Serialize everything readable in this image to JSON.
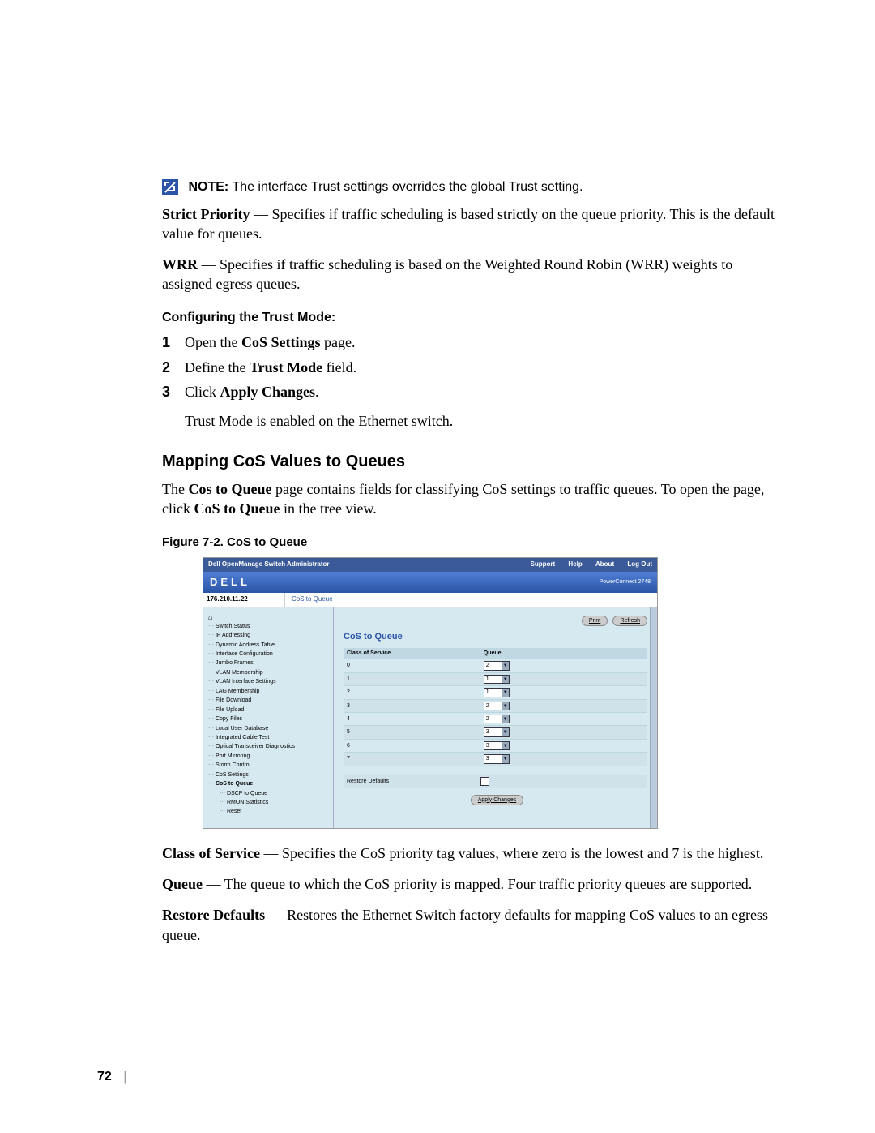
{
  "note": {
    "label": "NOTE:",
    "text": "The interface Trust settings overrides the global Trust setting."
  },
  "paras": {
    "strict": {
      "lead": "Strict Priority",
      "text": " — Specifies if traffic scheduling is based strictly on the queue priority. This is the default value for queues."
    },
    "wrr": {
      "lead": "WRR",
      "text": " — Specifies if traffic scheduling is based on the Weighted Round Robin (WRR) weights to assigned egress queues."
    }
  },
  "subheading": "Configuring the Trust Mode:",
  "steps": [
    {
      "num": "1",
      "pre": "Open the ",
      "bold": "CoS Settings",
      "post": " page."
    },
    {
      "num": "2",
      "pre": "Define the ",
      "bold": "Trust Mode",
      "post": " field."
    },
    {
      "num": "3",
      "pre": "Click ",
      "bold": "Apply Changes",
      "post": "."
    }
  ],
  "step_after": "Trust Mode is enabled on the Ethernet switch.",
  "section": "Mapping CoS Values to Queues",
  "section_text": {
    "pre": "The ",
    "b1": "Cos to Queue",
    "mid": " page contains fields for classifying CoS settings to traffic queues. To open the page, click ",
    "b2": "CoS to Queue",
    "post": " in the tree view."
  },
  "figure_caption": "Figure 7-2.    CoS to Queue",
  "mock": {
    "title": "Dell OpenManage Switch Administrator",
    "links": [
      "Support",
      "Help",
      "About",
      "Log Out"
    ],
    "logo": "DELL",
    "model": "PowerConnect 2748",
    "ip": "176.210.11.22",
    "crumb": "CoS to Queue",
    "tree": [
      "Switch Status",
      "IP Addressing",
      "Dynamic Address Table",
      "Interface Configuration",
      "Jumbo Frames",
      "VLAN Membership",
      "VLAN Interface Settings",
      "LAG Membership",
      "File Download",
      "File Upload",
      "Copy Files",
      "Local User Database",
      "Integrated Cable Test",
      "Optical Transceiver Diagnostics",
      "Port Mirroring",
      "Storm Control",
      "CoS Settings"
    ],
    "tree_active": "CoS to Queue",
    "tree_sub": [
      "DSCP to Queue",
      "RMON Statistics",
      "Reset"
    ],
    "panel_title": "CoS to Queue",
    "btn_print": "Print",
    "btn_refresh": "Refresh",
    "th_cos": "Class of Service",
    "th_q": "Queue",
    "rows": [
      {
        "c": "0",
        "q": "2"
      },
      {
        "c": "1",
        "q": "1"
      },
      {
        "c": "2",
        "q": "1"
      },
      {
        "c": "3",
        "q": "2"
      },
      {
        "c": "4",
        "q": "2"
      },
      {
        "c": "5",
        "q": "3"
      },
      {
        "c": "6",
        "q": "3"
      },
      {
        "c": "7",
        "q": "3"
      }
    ],
    "restore": "Restore Defaults",
    "apply": "Apply Changes"
  },
  "defs": {
    "cos": {
      "lead": "Class of Service",
      "text": " — Specifies the CoS priority tag values, where zero is the lowest and 7 is the highest."
    },
    "queue": {
      "lead": "Queue",
      "text": " — The queue to which the CoS priority is mapped. Four traffic priority queues are supported."
    },
    "restore": {
      "lead": "Restore Defaults",
      "text": " — Restores the Ethernet Switch factory defaults for mapping CoS values to an egress queue."
    }
  },
  "page_number": "72"
}
